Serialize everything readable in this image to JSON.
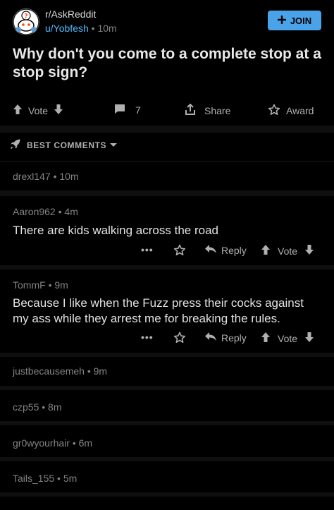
{
  "header": {
    "subreddit": "r/AskReddit",
    "user": "u/Yobfesh",
    "time": "10m",
    "join_label": "JOIN"
  },
  "post": {
    "title": "Why don't you come to a complete stop at a stop sign?",
    "vote_label": "Vote",
    "comment_count": "7",
    "share_label": "Share",
    "award_label": "Award"
  },
  "sort": {
    "label": "BEST COMMENTS"
  },
  "comments": [
    {
      "user": "drexl147",
      "time": "10m"
    },
    {
      "user": "Aaron962",
      "time": "4m",
      "text": "There are kids walking across the road",
      "reply": "Reply",
      "vote": "Vote"
    },
    {
      "user": "TommF",
      "time": "9m",
      "text": "Because I like when the Fuzz press their cocks against my ass while they arrest me for breaking the rules.",
      "reply": "Reply",
      "vote": "Vote"
    },
    {
      "user": "justbecausemeh",
      "time": "9m"
    },
    {
      "user": "czp55",
      "time": "8m"
    },
    {
      "user": "gr0wyourhair",
      "time": "6m"
    },
    {
      "user": "Tails_155",
      "time": "5m"
    }
  ],
  "colors": {
    "background": "#000000",
    "join": "#4aa3e8",
    "link": "#4fbcff"
  },
  "icons": [
    "snoo-avatar-icon",
    "plus-icon",
    "upvote-icon",
    "downvote-icon",
    "comment-icon",
    "share-icon",
    "award-icon",
    "rocket-icon",
    "chevron-down-icon",
    "more-icon",
    "reply-icon"
  ]
}
